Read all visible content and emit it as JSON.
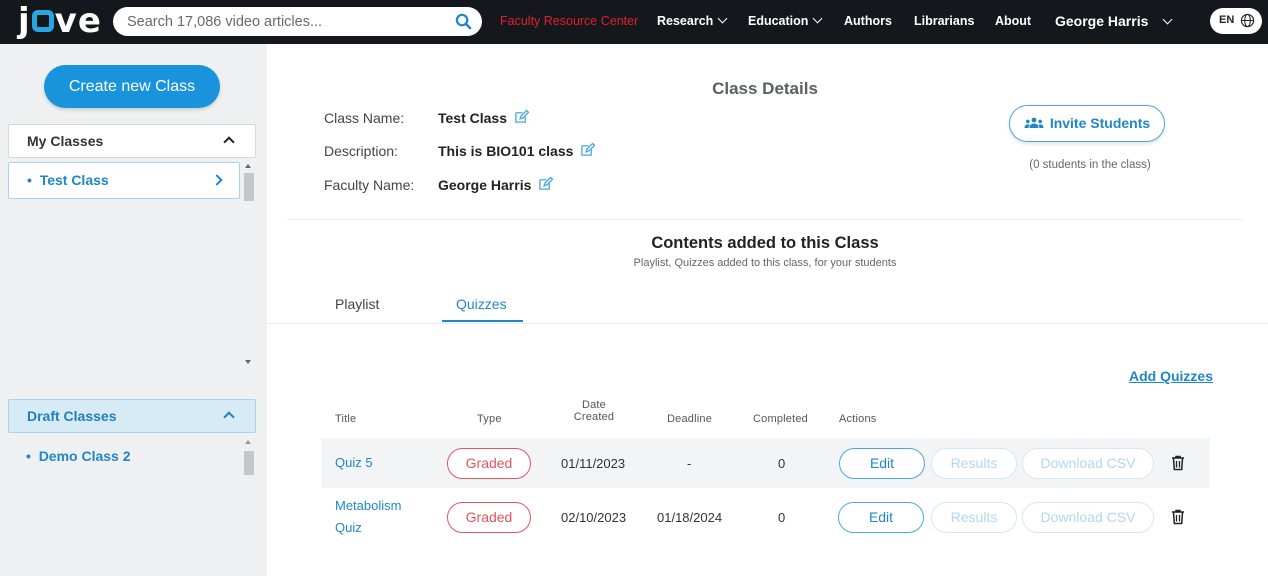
{
  "nav": {
    "logo": "jove",
    "search_placeholder": "Search 17,086 video articles...",
    "links": {
      "faculty": "Faculty Resource Center",
      "research": "Research",
      "education": "Education",
      "authors": "Authors",
      "librarians": "Librarians",
      "about": "About"
    },
    "user": "George Harris",
    "lang": "EN"
  },
  "sidebar": {
    "create_label": "Create new Class",
    "my_classes": {
      "label": "My Classes",
      "items": [
        "Test Class"
      ]
    },
    "draft_classes": {
      "label": "Draft Classes",
      "items": [
        "Demo Class 2"
      ]
    }
  },
  "details": {
    "title": "Class Details",
    "class_name_label": "Class Name:",
    "class_name": "Test Class",
    "description_label": "Description:",
    "description": "This is BIO101 class",
    "faculty_label": "Faculty Name:",
    "faculty": "George Harris",
    "invite_label": "Invite Students",
    "student_count": "(0 students in the class)"
  },
  "contents": {
    "title": "Contents added to this Class",
    "subtitle": "Playlist, Quizzes added to this class, for your students",
    "tabs": [
      "Playlist",
      "Quizzes"
    ],
    "active_tab": "Quizzes"
  },
  "quizzes": {
    "add_label": "Add Quizzes",
    "headers": {
      "title": "Title",
      "type": "Type",
      "date_line1": "Date",
      "date_line2": "Created",
      "deadline": "Deadline",
      "completed": "Completed",
      "actions": "Actions"
    },
    "rows": [
      {
        "title": "Quiz 5",
        "type": "Graded",
        "date": "01/11/2023",
        "deadline": "-",
        "completed": "0",
        "edit": "Edit",
        "results": "Results",
        "csv": "Download CSV"
      },
      {
        "title_line1": "Metabolism",
        "title_line2": "Quiz",
        "type": "Graded",
        "date": "02/10/2023",
        "deadline": "01/18/2024",
        "completed": "0",
        "edit": "Edit",
        "results": "Results",
        "csv": "Download CSV"
      }
    ]
  },
  "colors": {
    "accent": "#1f87c9",
    "primary_button": "#1994dc",
    "graded": "#e2565d",
    "nav_bg": "#14171c",
    "faculty_link": "#e21f2c"
  }
}
